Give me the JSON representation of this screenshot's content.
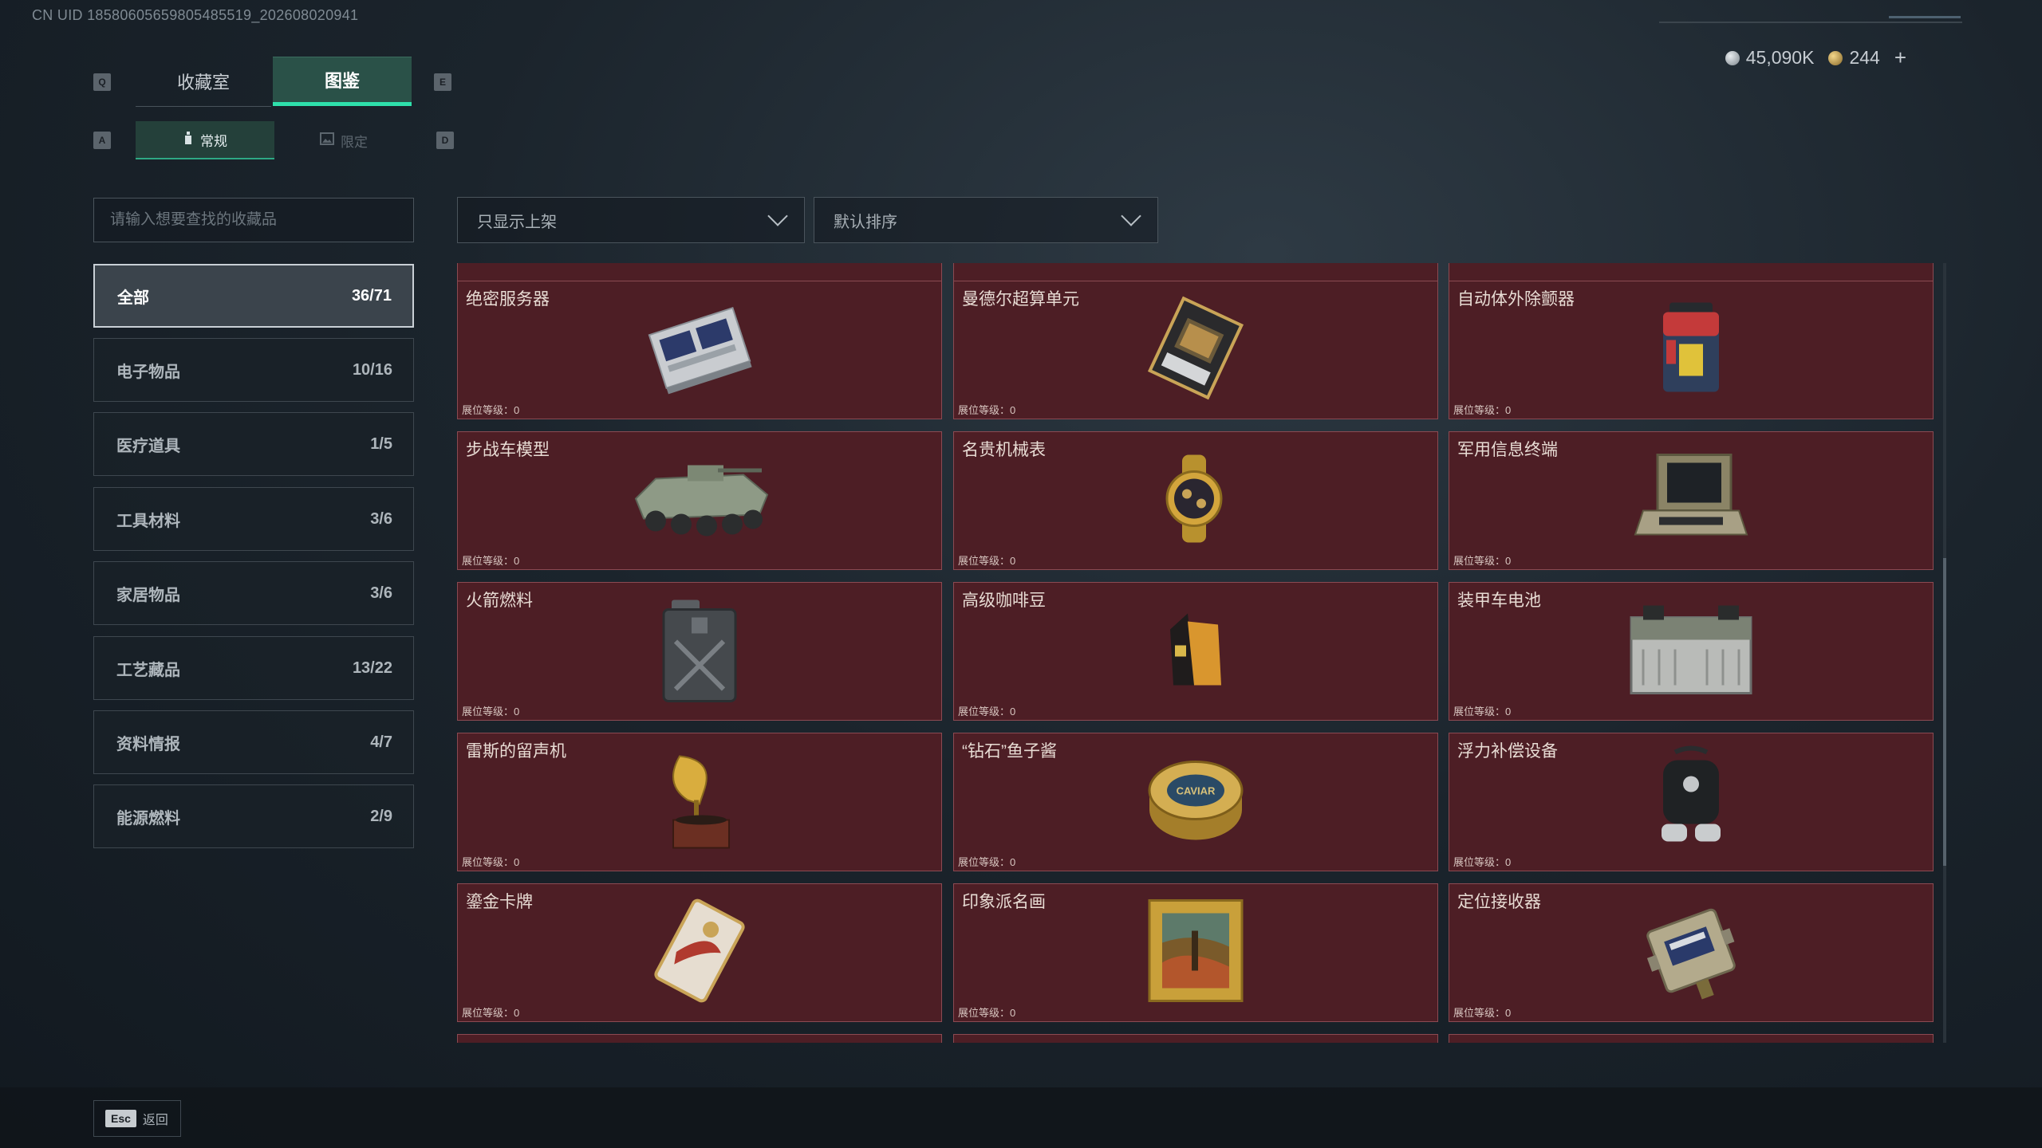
{
  "uid_text": "CN UID 1858060565980548551​9_202608020941",
  "keys": {
    "q": "Q",
    "e": "E",
    "a": "A",
    "d": "D"
  },
  "tabs": [
    {
      "label": "收藏室"
    },
    {
      "label": "图鉴"
    }
  ],
  "subtabs": [
    {
      "label": "常规"
    },
    {
      "label": "限定"
    }
  ],
  "currency": {
    "silver": "45,090K",
    "gold": "244",
    "add": "+"
  },
  "search": {
    "placeholder": "请输入想要查找的收藏品"
  },
  "filter": {
    "selected": "只显示上架"
  },
  "sort": {
    "selected": "默认排序"
  },
  "categories": [
    {
      "label": "全部",
      "count": "36/71"
    },
    {
      "label": "电子物品",
      "count": "10/16"
    },
    {
      "label": "医疗道具",
      "count": "1/5"
    },
    {
      "label": "工具材料",
      "count": "3/6"
    },
    {
      "label": "家居物品",
      "count": "3/6"
    },
    {
      "label": "工艺藏品",
      "count": "13/22"
    },
    {
      "label": "资料情报",
      "count": "4/7"
    },
    {
      "label": "能源燃料",
      "count": "2/9"
    }
  ],
  "level_label": "展位等级：0",
  "items": [
    {
      "name": "绝密服务器",
      "icon": "server-icon"
    },
    {
      "name": "曼德尔超算单元",
      "icon": "supercomputer-unit-icon"
    },
    {
      "name": "自动体外除颤器",
      "icon": "defibrillator-icon"
    },
    {
      "name": "步战车模型",
      "icon": "ifv-model-icon"
    },
    {
      "name": "名贵机械表",
      "icon": "watch-icon"
    },
    {
      "name": "军用信息终端",
      "icon": "military-terminal-icon"
    },
    {
      "name": "火箭燃料",
      "icon": "fuel-can-icon"
    },
    {
      "name": "高级咖啡豆",
      "icon": "coffee-bag-icon"
    },
    {
      "name": "装甲车电池",
      "icon": "battery-icon"
    },
    {
      "name": "雷斯的留声机",
      "icon": "gramophone-icon"
    },
    {
      "name": "“钻石”鱼子酱",
      "icon": "caviar-tin-icon",
      "tin_text": "CAVIAR"
    },
    {
      "name": "浮力补偿设备",
      "icon": "buoyancy-device-icon"
    },
    {
      "name": "鎏金卡牌",
      "icon": "gilded-card-icon"
    },
    {
      "name": "印象派名画",
      "icon": "framed-painting-icon"
    },
    {
      "name": "定位接收器",
      "icon": "locator-receiver-icon"
    }
  ],
  "bottom": {
    "esc_key": "Esc",
    "back_label": "返回"
  }
}
